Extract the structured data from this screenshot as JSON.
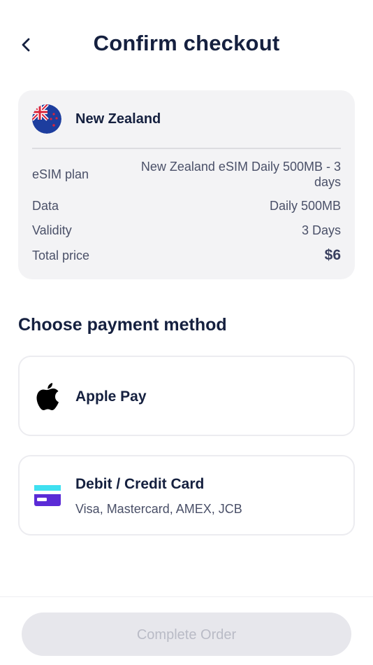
{
  "header": {
    "title": "Confirm checkout",
    "back_icon": "chevron-left-icon"
  },
  "summary": {
    "country": "New Zealand",
    "flag_icon": "new-zealand-flag-icon",
    "rows": [
      {
        "label": "eSIM plan",
        "value": "New Zealand eSIM Daily 500MB - 3 days"
      },
      {
        "label": "Data",
        "value": "Daily 500MB"
      },
      {
        "label": "Validity",
        "value": "3 Days"
      },
      {
        "label": "Total price",
        "value": "$6"
      }
    ]
  },
  "payment": {
    "section_title": "Choose payment method",
    "methods": [
      {
        "title": "Apple Pay",
        "icon": "apple-icon"
      },
      {
        "title": "Debit / Credit Card",
        "subtitle": "Visa, Mastercard, AMEX, JCB",
        "icon": "credit-card-icon"
      }
    ]
  },
  "footer": {
    "button_label": "Complete Order",
    "button_state": "disabled"
  },
  "colors": {
    "primary_text": "#15203f",
    "card_bg": "#f3f3f5",
    "card_icon_purple": "#5b2bd6",
    "card_icon_cyan": "#3fe0f0",
    "disabled_bg": "#e7e7ec"
  }
}
